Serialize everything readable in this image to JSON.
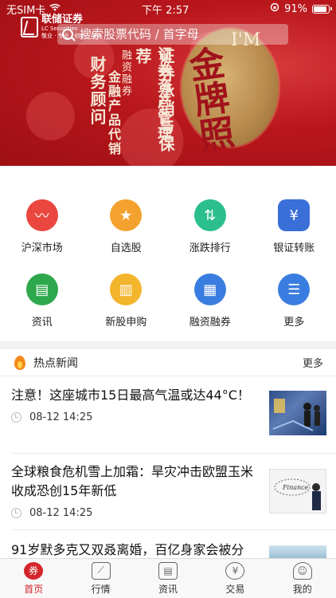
{
  "status_bar": {
    "carrier": "无SIM卡",
    "time": "下午 2:57",
    "battery": "91%"
  },
  "brand": {
    "name": "联储证券",
    "en": "LC Securities",
    "slogan": "敬业 · 专业 · 创新 · 服务"
  },
  "search": {
    "placeholder": "搜索股票代码 / 首字母"
  },
  "banner": {
    "words": [
      "财务顾问",
      "证券承销与保荐",
      "证券资产管理",
      "金融产品代销",
      "融资融券"
    ],
    "gold_text": "金牌照",
    "gold_en": "I'M"
  },
  "grid": [
    {
      "label": "沪深市场",
      "color": "#e9473f",
      "icon": "chart-line-icon",
      "glyph": "〰"
    },
    {
      "label": "自选股",
      "color": "#f4a22f",
      "icon": "star-icon",
      "glyph": "★"
    },
    {
      "label": "涨跌排行",
      "color": "#2bbf8e",
      "icon": "updown-arrow-icon",
      "glyph": "⇅"
    },
    {
      "label": "银证转账",
      "color": "#3a6fd8",
      "icon": "yuan-card-icon",
      "glyph": "¥"
    },
    {
      "label": "资讯",
      "color": "#2ea84d",
      "icon": "news-icon",
      "glyph": "▤"
    },
    {
      "label": "新股申购",
      "color": "#f3b52b",
      "icon": "new-stock-icon",
      "glyph": "▥"
    },
    {
      "label": "融资融券",
      "color": "#3a7de0",
      "icon": "margin-icon",
      "glyph": "▦"
    },
    {
      "label": "更多",
      "color": "#3a7de0",
      "icon": "more-icon",
      "glyph": "☰"
    }
  ],
  "hot_news": {
    "heading": "热点新闻",
    "more": "更多",
    "items": [
      {
        "title": "注意！这座城市15日最高气温或达44°C！",
        "time": "08-12 14:25"
      },
      {
        "title": "全球粮食危机雪上加霜：旱灾冲击欧盟玉米收成恐创15年新低",
        "time": "08-12 14:25"
      },
      {
        "title": "91岁默多克又双叒离婚，百亿身家会被分",
        "time": ""
      }
    ],
    "thumb2_word": "Finance"
  },
  "tabbar": [
    {
      "label": "首页",
      "icon": "home-icon",
      "glyph": "券"
    },
    {
      "label": "行情",
      "icon": "market-icon",
      "glyph": "⟋"
    },
    {
      "label": "资讯",
      "icon": "info-icon",
      "glyph": "▤"
    },
    {
      "label": "交易",
      "icon": "trade-icon",
      "glyph": "¥"
    },
    {
      "label": "我的",
      "icon": "profile-icon",
      "glyph": "☺"
    }
  ],
  "colors": {
    "accent": "#d4262b",
    "banner_red": "#b8171c"
  }
}
